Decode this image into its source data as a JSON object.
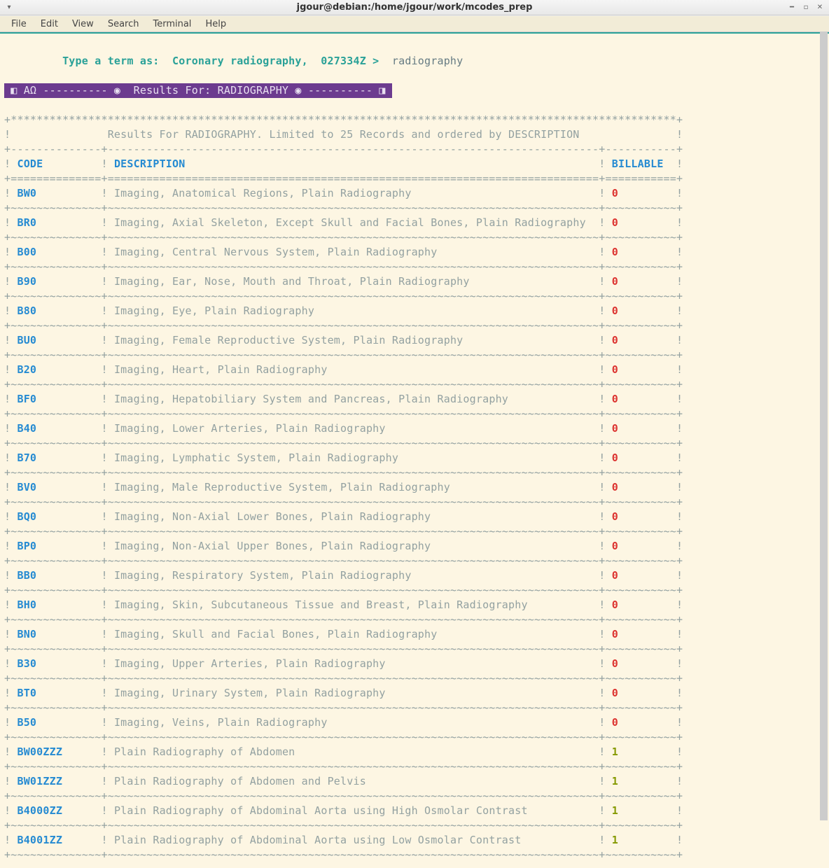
{
  "window": {
    "title": "jgour@debian:/home/jgour/work/mcodes_prep"
  },
  "menu": {
    "file": "File",
    "edit": "Edit",
    "view": "View",
    "search": "Search",
    "terminal": "Terminal",
    "help": "Help"
  },
  "prompt": {
    "label": "Type a term as:  Coronary radiography,  027334Z > ",
    "value": "radiography"
  },
  "banner": "◧ ΑΩ ---------- ◉  Results For: RADIOGRAPHY ◉ ---------- ◨",
  "header_line": "Results For RADIOGRAPHY. Limited to 25 Records and ordered by DESCRIPTION",
  "columns": {
    "code": "CODE",
    "description": "DESCRIPTION",
    "billable": "BILLABLE"
  },
  "rows": [
    {
      "code": "BW0",
      "desc": "Imaging, Anatomical Regions, Plain Radiography",
      "billable": "0"
    },
    {
      "code": "BR0",
      "desc": "Imaging, Axial Skeleton, Except Skull and Facial Bones, Plain Radiography",
      "billable": "0"
    },
    {
      "code": "B00",
      "desc": "Imaging, Central Nervous System, Plain Radiography",
      "billable": "0"
    },
    {
      "code": "B90",
      "desc": "Imaging, Ear, Nose, Mouth and Throat, Plain Radiography",
      "billable": "0"
    },
    {
      "code": "B80",
      "desc": "Imaging, Eye, Plain Radiography",
      "billable": "0"
    },
    {
      "code": "BU0",
      "desc": "Imaging, Female Reproductive System, Plain Radiography",
      "billable": "0"
    },
    {
      "code": "B20",
      "desc": "Imaging, Heart, Plain Radiography",
      "billable": "0"
    },
    {
      "code": "BF0",
      "desc": "Imaging, Hepatobiliary System and Pancreas, Plain Radiography",
      "billable": "0"
    },
    {
      "code": "B40",
      "desc": "Imaging, Lower Arteries, Plain Radiography",
      "billable": "0"
    },
    {
      "code": "B70",
      "desc": "Imaging, Lymphatic System, Plain Radiography",
      "billable": "0"
    },
    {
      "code": "BV0",
      "desc": "Imaging, Male Reproductive System, Plain Radiography",
      "billable": "0"
    },
    {
      "code": "BQ0",
      "desc": "Imaging, Non-Axial Lower Bones, Plain Radiography",
      "billable": "0"
    },
    {
      "code": "BP0",
      "desc": "Imaging, Non-Axial Upper Bones, Plain Radiography",
      "billable": "0"
    },
    {
      "code": "BB0",
      "desc": "Imaging, Respiratory System, Plain Radiography",
      "billable": "0"
    },
    {
      "code": "BH0",
      "desc": "Imaging, Skin, Subcutaneous Tissue and Breast, Plain Radiography",
      "billable": "0"
    },
    {
      "code": "BN0",
      "desc": "Imaging, Skull and Facial Bones, Plain Radiography",
      "billable": "0"
    },
    {
      "code": "B30",
      "desc": "Imaging, Upper Arteries, Plain Radiography",
      "billable": "0"
    },
    {
      "code": "BT0",
      "desc": "Imaging, Urinary System, Plain Radiography",
      "billable": "0"
    },
    {
      "code": "B50",
      "desc": "Imaging, Veins, Plain Radiography",
      "billable": "0"
    },
    {
      "code": "BW00ZZZ",
      "desc": "Plain Radiography of Abdomen",
      "billable": "1"
    },
    {
      "code": "BW01ZZZ",
      "desc": "Plain Radiography of Abdomen and Pelvis",
      "billable": "1"
    },
    {
      "code": "B4000ZZ",
      "desc": "Plain Radiography of Abdominal Aorta using High Osmolar Contrast",
      "billable": "1"
    },
    {
      "code": "B4001ZZ",
      "desc": "Plain Radiography of Abdominal Aorta using Low Osmolar Contrast",
      "billable": "1"
    }
  ],
  "widths": {
    "code": 12,
    "desc": 74,
    "billable": 9
  }
}
